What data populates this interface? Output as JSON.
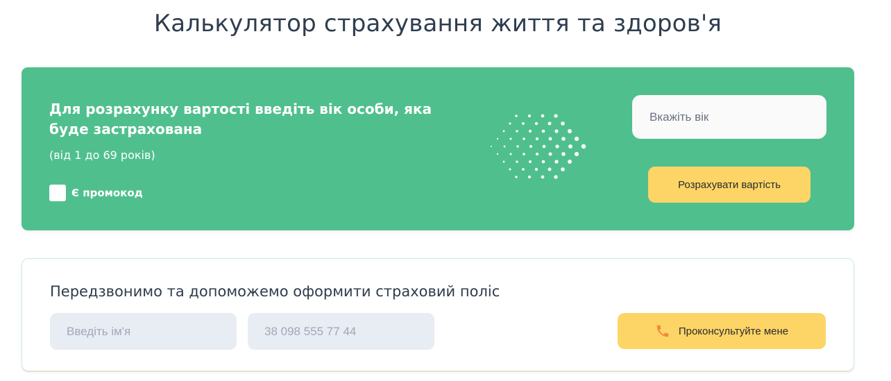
{
  "page": {
    "title": "Калькулятор страхування життя та здоров'я"
  },
  "calculator": {
    "heading": "Для розрахунку вартості введіть вік особи, яка буде застрахована",
    "range_note": "(від 1 до 69 років)",
    "promo_label": "Є промокод",
    "age_placeholder": "Вкажіть вік",
    "calculate_label": "Розрахувати вартість",
    "background_color": "#50bf8e",
    "button_color": "#fdd466"
  },
  "callback": {
    "heading": "Передзвонимо та допоможемо оформити страховий поліс",
    "name_placeholder": "Введіть ім'я",
    "phone_placeholder": "38 098 555 77 44",
    "consult_label": "Проконсультуйте мене",
    "consult_icon": "phone-icon",
    "field_color": "#e8ecf3"
  }
}
